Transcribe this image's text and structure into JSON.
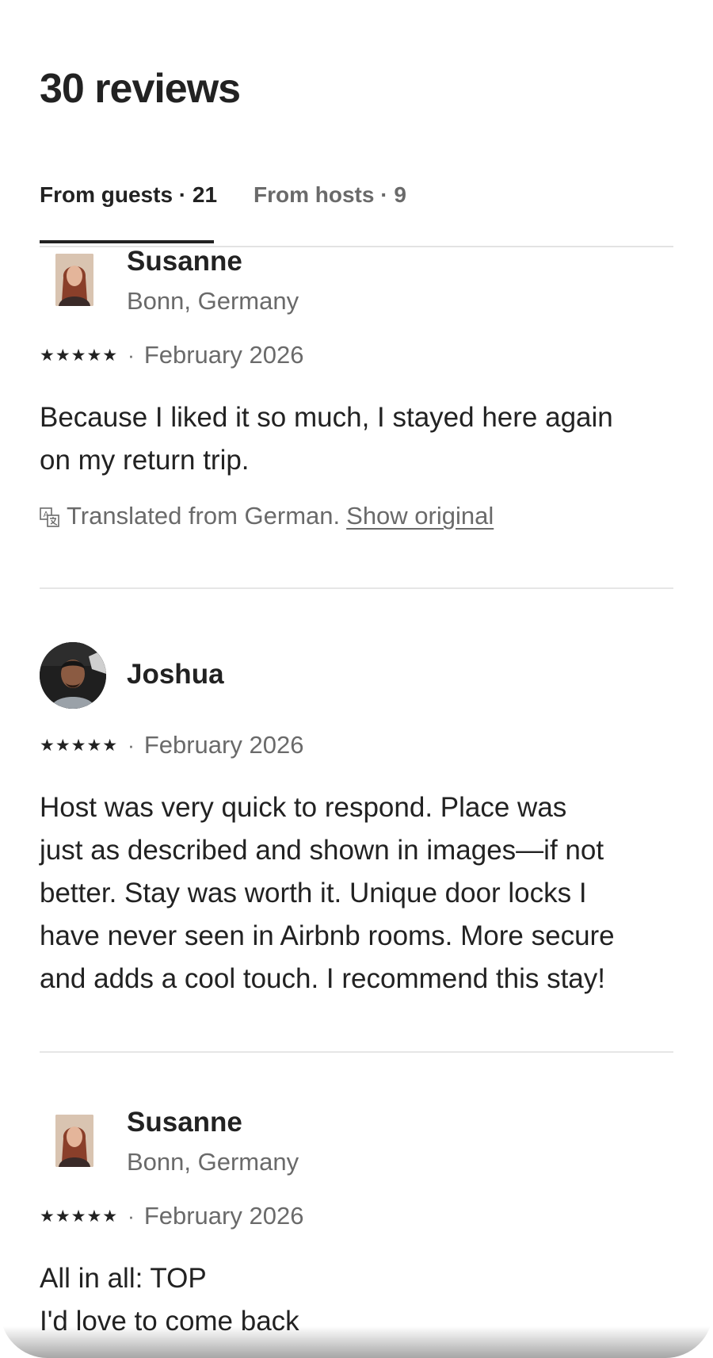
{
  "header": {
    "title": "30 reviews"
  },
  "tabs": [
    {
      "label": "From guests · 21",
      "active": true
    },
    {
      "label": "From hosts · 9",
      "active": false
    }
  ],
  "reviews": [
    {
      "name": "Susanne",
      "location": "Bonn, Germany",
      "stars": "★★★★★",
      "rating": 5,
      "date": "February 2026",
      "text": "Because I liked it so much, I stayed here again\non my return trip.",
      "translated_text": "Translated from German.",
      "show_original": "Show original"
    },
    {
      "name": "Joshua",
      "stars": "★★★★★",
      "rating": 5,
      "date": "February 2026",
      "text": "Host was very quick to respond. Place was\njust as described and shown in images—if not\nbetter. Stay was worth it. Unique door locks I\nhave never seen in Airbnb rooms. More secure\nand adds a cool touch. I recommend this stay!"
    },
    {
      "name": "Susanne",
      "location": "Bonn, Germany",
      "stars": "★★★★★",
      "rating": 5,
      "date": "February 2026",
      "text": "All in all: TOP\nI'd love to come back"
    }
  ],
  "separator": "·",
  "colors": {
    "text_primary": "#222222",
    "text_secondary": "#6a6a6a",
    "divider": "#e6e6e6"
  }
}
